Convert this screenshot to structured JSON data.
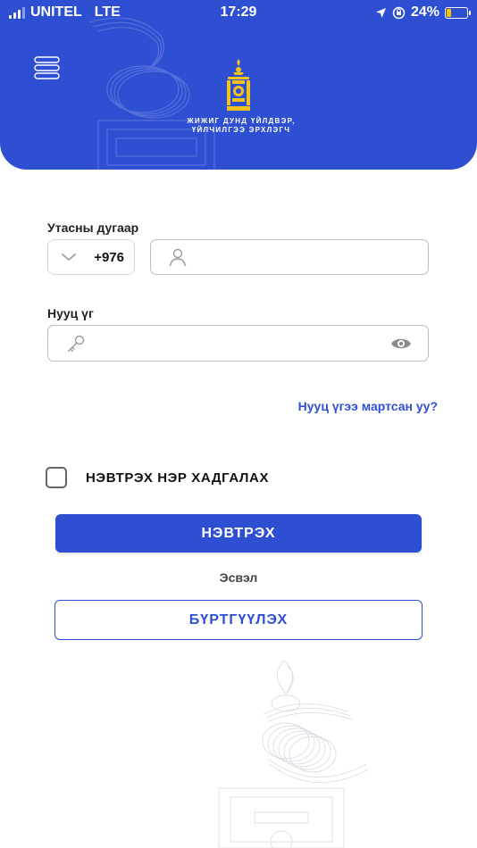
{
  "status_bar": {
    "carrier": "UNITEL",
    "network": "LTE",
    "time": "17:29",
    "battery": "24%",
    "battery_level": 0.24,
    "battery_color": "#f5c400"
  },
  "header": {
    "menu_icon": "menu-icon",
    "emblem_icon": "mongolia-emblem-icon",
    "org_name_line1": "ЖИЖИГ ДУНД ҮЙЛДВЭР,",
    "org_name_line2": "ҮЙЛЧИЛГЭЭ ЭРХЛЭГЧ",
    "bg_color": "#2f4fd3"
  },
  "form": {
    "phone_label": "Утасны дугаар",
    "country_code": "+976",
    "phone_value": "",
    "phone_placeholder": "",
    "password_label": "Нууц үг",
    "password_value": "",
    "password_placeholder": "",
    "forgot_link": "Нууц үгээ мартсан уу?",
    "remember_label": "НЭВТРЭХ НЭР ХАДГАЛАХ",
    "remember_checked": false
  },
  "actions": {
    "login_label": "НЭВТРЭХ",
    "or_text": "Эсвэл",
    "register_label": "БҮРТГҮҮЛЭХ",
    "accent_color": "#2f4fd3"
  }
}
